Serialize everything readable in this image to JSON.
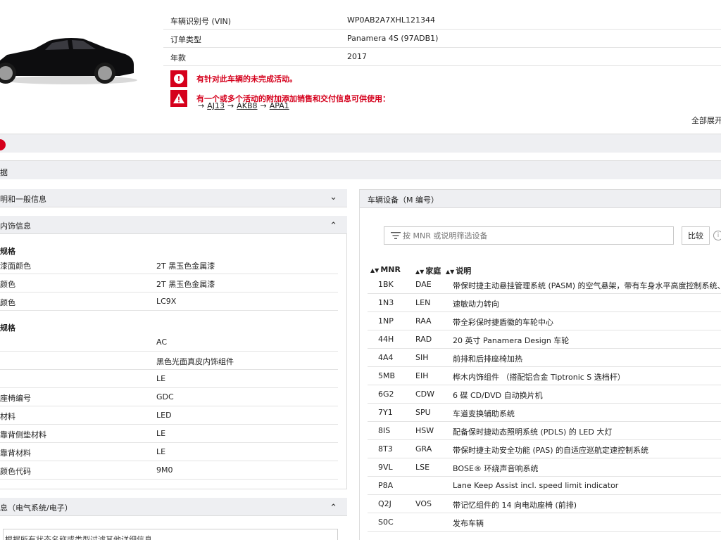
{
  "vehicle": {
    "rows": [
      {
        "label": "车辆识别号 (VIN)",
        "value": "WP0AB2A7XHL121344"
      },
      {
        "label": "订单类型",
        "value": "Panamera 4S (97ADB1)"
      },
      {
        "label": "年款",
        "value": "2017"
      }
    ],
    "alerts": [
      {
        "icon": "exclamation-circle-icon",
        "text": "有针对此车辆的未完成活动。"
      },
      {
        "icon": "warning-triangle-icon",
        "text": "有一个或多个活动的附加添加销售和交付信息可供使用："
      }
    ],
    "alert_links": [
      "AJ13",
      "AKB8",
      "APA1"
    ],
    "arrow": "→",
    "expand_all": "全部展开"
  },
  "bars": {
    "data_title": "据"
  },
  "left": {
    "panel_general": "明和一般信息",
    "panel_interior": "内饰信息",
    "groups": [
      {
        "title": "规格",
        "rows": [
          {
            "label": "漆面颜色",
            "value": "2T 黑玉色金属漆"
          },
          {
            "label": "颜色",
            "value": "2T 黑玉色金属漆"
          },
          {
            "label": "颜色",
            "value": "LC9X"
          }
        ]
      },
      {
        "title": "规格",
        "rows": [
          {
            "label": "",
            "value": "AC"
          },
          {
            "label": "",
            "value": "黑色光面真皮内饰组件"
          },
          {
            "label": "",
            "value": "LE"
          },
          {
            "label": "座椅编号",
            "value": "GDC"
          },
          {
            "label": "材料",
            "value": "LED"
          },
          {
            "label": "靠背侧垫材料",
            "value": "LE"
          },
          {
            "label": "靠背材料",
            "value": "LE"
          },
          {
            "label": "颜色代码",
            "value": "9M0"
          }
        ]
      }
    ],
    "panel_electrical": "息（电气系统/电子）",
    "hint": "根据所有状态名称或类型过滤其他详细信息"
  },
  "right": {
    "panel_title": "车辆设备（M 编号）",
    "filter_placeholder": "按 MNR 或说明筛选设备",
    "compare_label": "比较",
    "columns": [
      "MNR",
      "家庭",
      "说明"
    ],
    "equipment": [
      {
        "mnr": "1BK",
        "family": "DAE",
        "desc": "带保时捷主动悬挂管理系统 (PASM) 的空气悬架，带有车身水平高度控制系统、..."
      },
      {
        "mnr": "1N3",
        "family": "LEN",
        "desc": "速敏动力转向"
      },
      {
        "mnr": "1NP",
        "family": "RAA",
        "desc": "带全彩保时捷盾徽的车轮中心"
      },
      {
        "mnr": "44H",
        "family": "RAD",
        "desc": "20 英寸 Panamera Design 车轮"
      },
      {
        "mnr": "4A4",
        "family": "SIH",
        "desc": "前排和后排座椅加热"
      },
      {
        "mnr": "5MB",
        "family": "EIH",
        "desc": "桦木内饰组件 （搭配铝合金 Tiptronic S 选档杆）"
      },
      {
        "mnr": "6G2",
        "family": "CDW",
        "desc": "6 碟 CD/DVD 自动换片机"
      },
      {
        "mnr": "7Y1",
        "family": "SPU",
        "desc": "车道变换辅助系统"
      },
      {
        "mnr": "8IS",
        "family": "HSW",
        "desc": "配备保时捷动态照明系统 (PDLS) 的 LED 大灯"
      },
      {
        "mnr": "8T3",
        "family": "GRA",
        "desc": "带保时捷主动安全功能 (PAS) 的自适应巡航定速控制系统"
      },
      {
        "mnr": "9VL",
        "family": "LSE",
        "desc": "BOSE® 环绕声音响系统"
      },
      {
        "mnr": "P8A",
        "family": "",
        "desc": "Lane Keep Assist incl. speed limit indicator"
      },
      {
        "mnr": "Q2J",
        "family": "VOS",
        "desc": "带记忆组件的 14 向电动座椅 (前排)"
      },
      {
        "mnr": "S0C",
        "family": "",
        "desc": "发布车辆"
      }
    ]
  },
  "colors": {
    "accent_red": "#d5001c",
    "bar_grey": "#eeeff2",
    "car_body": "#0d0d0f"
  }
}
